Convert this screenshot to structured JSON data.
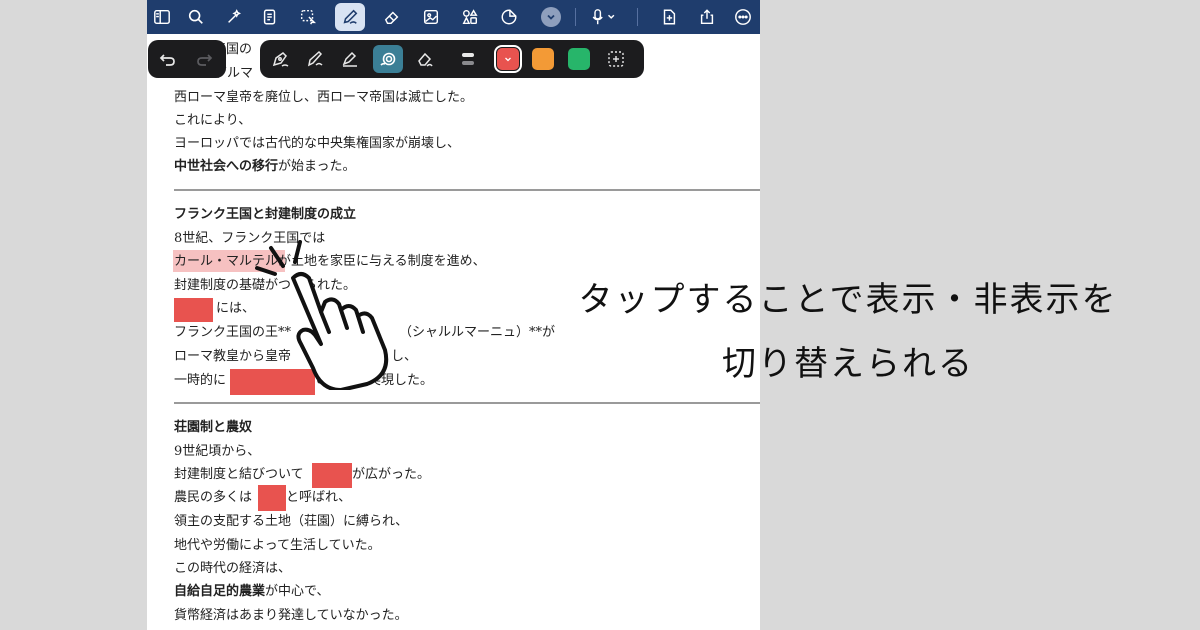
{
  "toolbar": {
    "icons": [
      "sidebar-icon",
      "search-icon",
      "magic-icon",
      "document-icon",
      "lasso-icon",
      "pen-icon",
      "eraser-icon",
      "image-icon",
      "shapes-icon",
      "sticker-icon",
      "chevron-down-icon",
      "microphone-icon",
      "add-page-icon",
      "share-icon",
      "more-icon"
    ]
  },
  "pen_tools": {
    "undo": "undo-icon",
    "redo": "redo-icon",
    "tools": [
      "fountain-pen-icon",
      "brush-pen-icon",
      "ballpoint-pen-icon",
      "highlighter-icon",
      "eraser-tool-icon",
      "stroke-width-icon"
    ],
    "colors": [
      "#e8534f",
      "#f39a36",
      "#27b56a"
    ],
    "selected_color": "#e8534f"
  },
  "document": {
    "lines": [
      {
        "text": "ローマ帝国の",
        "y": 47
      },
      {
        "text": "ゲルマ",
        "y": 72
      },
      {
        "text": "西ローマ皇帝を廃位し、西ローマ帝国は滅亡した。"
      },
      {
        "text": "これにより、"
      },
      {
        "text": "ヨーロッパでは古代的な中央集権国家が崩壊し、"
      },
      {
        "bold": "中世社会への移行",
        "text": "が始まった。"
      }
    ],
    "section2": {
      "heading": "フランク王国と封建制度の成立",
      "l1": "8世紀、フランク王国では",
      "l2a": "カール・マルテル",
      "l2b": "が土地を家臣に与える制度を進め、",
      "l3": "封建制度の基礎が",
      "l3b": "つくられた。",
      "l4": "には、",
      "l5a": "フランク王国の王**",
      "l5b": "（シャルルマーニュ）**が",
      "l6a": "ローマ教皇から皇帝",
      "l6b": "し、",
      "l7a": "一時的に",
      "l7b": "の統一が実現した。"
    },
    "section3": {
      "heading": "荘園制と農奴",
      "l1": "9世紀頃から、",
      "l2a": "封建制度と結びついて",
      "l2b": "が広がった。",
      "l3a": "農民の多くは",
      "l3b": "と呼ばれ、",
      "l4": "領主の支配する土地（荘園）に縛られ、",
      "l5": "地代や労働によって生活していた。",
      "l6": "この時代の経済は、",
      "l7a": "自給自足的農業",
      "l7b": "が中心で、",
      "l8": "貨幣経済はあまり発達していなかった。"
    }
  },
  "caption": {
    "line1": "タップすることで表示・非表示を",
    "line2": "切り替えられる"
  }
}
